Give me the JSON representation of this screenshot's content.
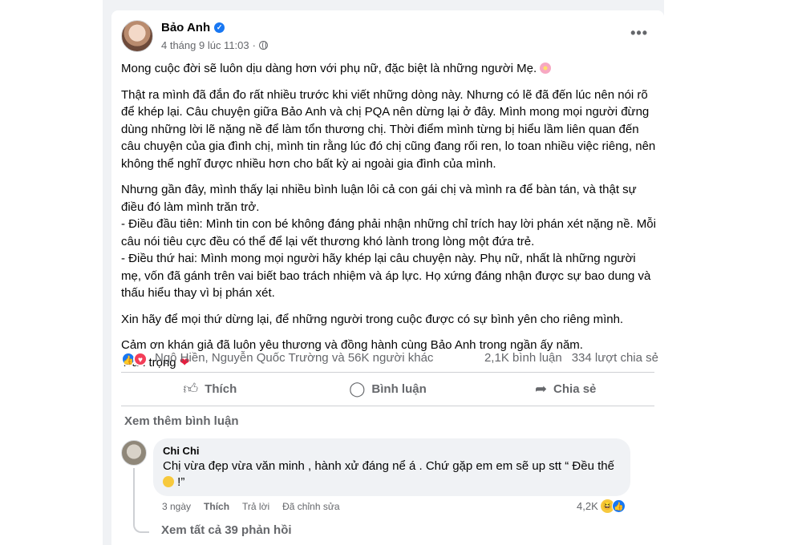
{
  "post": {
    "author": "Bảo Anh",
    "verified_mark": "✓",
    "timestamp": "4 tháng 9 lúc 11:03",
    "dot": "·",
    "more_label": "•••",
    "paragraphs": [
      "Mong cuộc đời sẽ luôn dịu dàng hơn với phụ nữ, đặc biệt là những người Mẹ.",
      "Thật ra mình đã đắn đo rất nhiều trước khi viết những dòng này. Nhưng có lẽ đã đến lúc nên nói rõ để khép lại. Câu chuyện giữa Bảo Anh và chị PQA nên dừng lại ở đây. Mình mong mọi người đừng dùng những lời lẽ nặng nề để làm tổn thương chị. Thời điểm mình từng bị hiểu lầm liên quan đến câu chuyện của gia đình chị, mình tin rằng lúc đó chị cũng đang rối ren, lo toan nhiều việc riêng, nên không thể nghĩ được nhiều hơn cho bất kỳ ai ngoài gia đình của mình.",
      "Nhưng gần đây, mình thấy lại nhiều bình luận lôi cả con gái chị và mình ra để bàn tán, và thật sự điều đó làm mình trăn trở.\n- Điều đầu tiên: Mình tin con bé không đáng phải nhận những chỉ trích hay lời phán xét nặng nề. Mỗi câu nói tiêu cực đều có thể để lại vết thương khó lành trong lòng một đứa trẻ.\n- Điều thứ hai: Mình mong mọi người hãy khép lại câu chuyện này. Phụ nữ, nhất là những người mẹ, vốn đã gánh trên vai biết bao trách nhiệm và áp lực. Họ xứng đáng nhận được sự bao dung và thấu hiểu thay vì bị phán xét.",
      "Xin hãy để mọi thứ dừng lại, để những người trong cuộc được có sự bình yên cho riêng mình.",
      "Cảm ơn khán giả đã luôn yêu thương và đồng hành cùng Bảo Anh trong ngần ấy năm.\nTrân trọng"
    ],
    "heart_emoji": "❤",
    "reactions": {
      "like_icon": "👍",
      "love_icon": "♥",
      "names": "Ngô Hiền, Nguyễn Quốc Trường và 56K người khác",
      "comments_count": "2,1K bình luận",
      "shares_count": "334 lượt chia sẻ"
    },
    "actions": [
      {
        "icon": "👍︎",
        "label": "Thích"
      },
      {
        "icon": "◯",
        "label": "Bình luận"
      },
      {
        "icon": "➦",
        "label": "Chia sẻ"
      }
    ]
  },
  "comments": {
    "view_more": "Xem thêm bình luận",
    "items": [
      {
        "author": "Chi Chi",
        "text": "Chị vừa đẹp vừa văn minh , hành xử đáng nể á . Chứ gặp em em sẽ up stt “ Đều thế",
        "text_end": " !”",
        "time": "3 ngày",
        "like": "Thích",
        "reply": "Trả lời",
        "edited": "Đã chỉnh sửa",
        "reaction_count": "4,2K",
        "haha_icon": "😆",
        "like_icon": "👍"
      }
    ],
    "view_replies": "Xem tất cả 39 phản hồi"
  }
}
